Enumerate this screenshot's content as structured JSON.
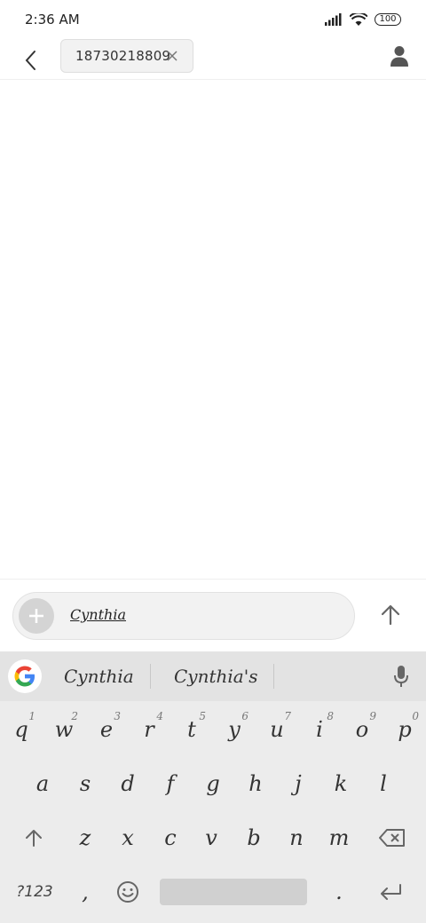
{
  "status": {
    "time": "2:36 AM",
    "battery": "100",
    "icons": [
      "signal-icon",
      "wifi-icon",
      "battery-icon"
    ]
  },
  "header": {
    "recipient": "18730218809",
    "icons": [
      "back-icon",
      "close-icon",
      "contact-icon"
    ]
  },
  "composer": {
    "text": "Cynthia",
    "icons": [
      "plus-icon",
      "send-arrow-icon"
    ]
  },
  "keyboard": {
    "suggestions": [
      "Cynthia",
      "Cynthia's"
    ],
    "row1": [
      {
        "k": "q",
        "n": "1"
      },
      {
        "k": "w",
        "n": "2"
      },
      {
        "k": "e",
        "n": "3"
      },
      {
        "k": "r",
        "n": "4"
      },
      {
        "k": "t",
        "n": "5"
      },
      {
        "k": "y",
        "n": "6"
      },
      {
        "k": "u",
        "n": "7"
      },
      {
        "k": "i",
        "n": "8"
      },
      {
        "k": "o",
        "n": "9"
      },
      {
        "k": "p",
        "n": "0"
      }
    ],
    "row2": [
      "a",
      "s",
      "d",
      "f",
      "g",
      "h",
      "j",
      "k",
      "l"
    ],
    "row3": [
      "z",
      "x",
      "c",
      "v",
      "b",
      "n",
      "m"
    ],
    "symbols_label": "?123",
    "comma": ",",
    "period": ".",
    "icons": [
      "google-icon",
      "mic-icon",
      "shift-icon",
      "backspace-icon",
      "emoji-icon",
      "enter-icon"
    ],
    "colors": {
      "background": "#ececec",
      "suggestion_bar": "#e3e3e3"
    }
  }
}
